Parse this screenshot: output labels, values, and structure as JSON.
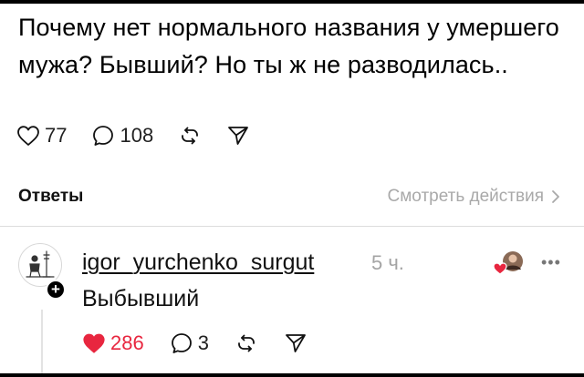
{
  "post": {
    "text": "Почему нет нормального названия у умершего мужа?  Бывший? Но ты ж не разводилась..",
    "likes": "77",
    "comments": "108"
  },
  "replies_section": {
    "title": "Ответы",
    "view_activity": "Смотреть действия"
  },
  "reply": {
    "username": "igor_yurchenko_surgut",
    "time": "5 ч.",
    "text": "Выбывший",
    "likes": "286",
    "comments": "3",
    "liked": true
  },
  "icons": {
    "like": "heart-icon",
    "comment": "speech-bubble-icon",
    "repost": "repost-icon",
    "share": "send-icon",
    "chevron": "chevron-right-icon",
    "more": "more-dots-icon"
  },
  "colors": {
    "like_red": "#e8263f",
    "muted": "#a9a9a9"
  }
}
